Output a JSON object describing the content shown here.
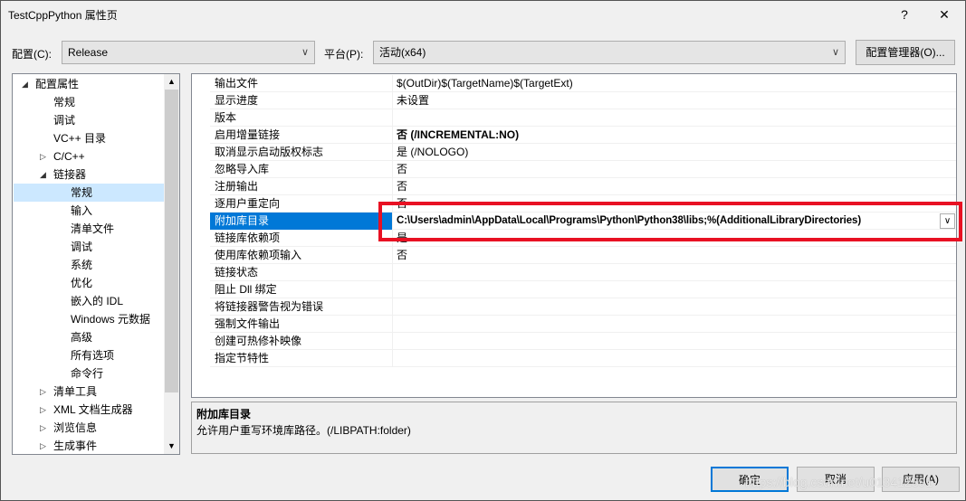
{
  "window": {
    "title": "TestCppPython 属性页",
    "help": "?",
    "close": "✕"
  },
  "config": {
    "label": "配置(C):",
    "value": "Release",
    "platform_label": "平台(P):",
    "platform_value": "活动(x64)",
    "manager_button": "配置管理器(O)..."
  },
  "tree": [
    {
      "label": "配置属性",
      "level": 0,
      "expander": "expanded"
    },
    {
      "label": "常规",
      "level": 1
    },
    {
      "label": "调试",
      "level": 1
    },
    {
      "label": "VC++ 目录",
      "level": 1
    },
    {
      "label": "C/C++",
      "level": 1,
      "expander": "collapsed"
    },
    {
      "label": "链接器",
      "level": 1,
      "expander": "expanded"
    },
    {
      "label": "常规",
      "level": 2,
      "selected": true
    },
    {
      "label": "输入",
      "level": 2
    },
    {
      "label": "清单文件",
      "level": 2
    },
    {
      "label": "调试",
      "level": 2
    },
    {
      "label": "系统",
      "level": 2
    },
    {
      "label": "优化",
      "level": 2
    },
    {
      "label": "嵌入的 IDL",
      "level": 2
    },
    {
      "label": "Windows 元数据",
      "level": 2
    },
    {
      "label": "高级",
      "level": 2
    },
    {
      "label": "所有选项",
      "level": 2
    },
    {
      "label": "命令行",
      "level": 2
    },
    {
      "label": "清单工具",
      "level": 1,
      "expander": "collapsed"
    },
    {
      "label": "XML 文档生成器",
      "level": 1,
      "expander": "collapsed"
    },
    {
      "label": "浏览信息",
      "level": 1,
      "expander": "collapsed"
    },
    {
      "label": "生成事件",
      "level": 1,
      "expander": "collapsed"
    }
  ],
  "properties": [
    {
      "name": "输出文件",
      "value": "$(OutDir)$(TargetName)$(TargetExt)"
    },
    {
      "name": "显示进度",
      "value": "未设置"
    },
    {
      "name": "版本",
      "value": ""
    },
    {
      "name": "启用增量链接",
      "value": "否 (/INCREMENTAL:NO)",
      "bold": true
    },
    {
      "name": "取消显示启动版权标志",
      "value": "是 (/NOLOGO)"
    },
    {
      "name": "忽略导入库",
      "value": "否"
    },
    {
      "name": "注册输出",
      "value": "否"
    },
    {
      "name": "逐用户重定向",
      "value": "否"
    },
    {
      "name": "附加库目录",
      "value": "C:\\Users\\admin\\AppData\\Local\\Programs\\Python\\Python38\\libs;%(AdditionalLibraryDirectories)",
      "bold": true,
      "selected": true
    },
    {
      "name": "链接库依赖项",
      "value": "是"
    },
    {
      "name": "使用库依赖项输入",
      "value": "否"
    },
    {
      "name": "链接状态",
      "value": ""
    },
    {
      "name": "阻止 Dll 绑定",
      "value": ""
    },
    {
      "name": "将链接器警告视为错误",
      "value": ""
    },
    {
      "name": "强制文件输出",
      "value": ""
    },
    {
      "name": "创建可热修补映像",
      "value": ""
    },
    {
      "name": "指定节特性",
      "value": ""
    }
  ],
  "description": {
    "title": "附加库目录",
    "text": "允许用户重写环境库路径。(/LIBPATH:folder)"
  },
  "buttons": {
    "ok": "确定",
    "cancel": "取消",
    "apply": "应用(A)"
  },
  "watermark": "https://blog.csdn.net/u013412391",
  "colors": {
    "selection": "#0078d7",
    "highlight_box": "#e81123",
    "tree_selection": "#cce8ff"
  }
}
